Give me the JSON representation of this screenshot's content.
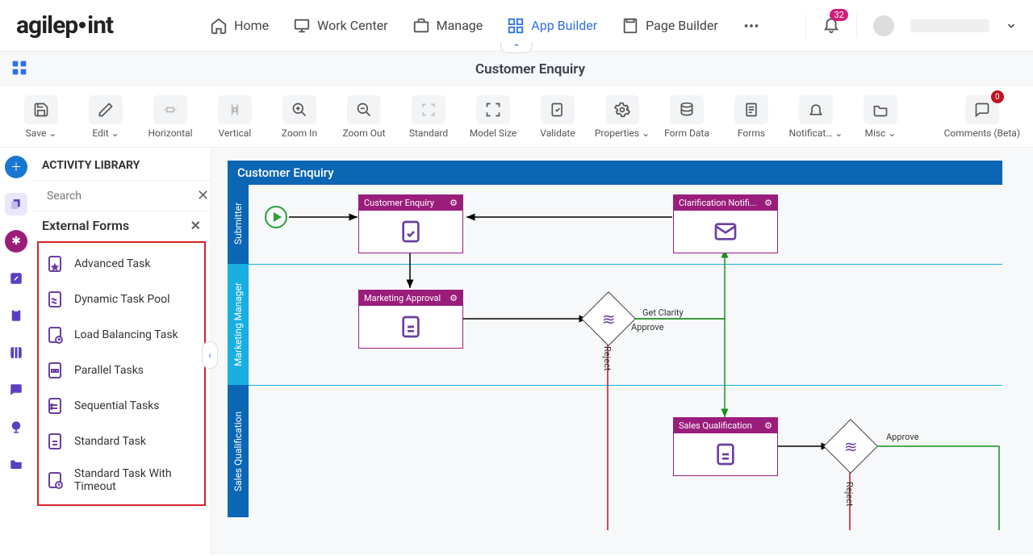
{
  "nav": {
    "home": "Home",
    "workcenter": "Work Center",
    "manage": "Manage",
    "appbuilder": "App Builder",
    "pagebuilder": "Page Builder",
    "notif_count": "32"
  },
  "page": {
    "title": "Customer Enquiry"
  },
  "toolbar": {
    "save": "Save",
    "edit": "Edit",
    "horizontal": "Horizontal",
    "vertical": "Vertical",
    "zoomin": "Zoom In",
    "zoomout": "Zoom Out",
    "standard": "Standard",
    "modelsize": "Model Size",
    "validate": "Validate",
    "properties": "Properties",
    "formdata": "Form Data",
    "forms": "Forms",
    "notifications": "Notificat…",
    "misc": "Misc",
    "comments": "Comments (Beta)",
    "comments_count": "0"
  },
  "library": {
    "heading": "ACTIVITY LIBRARY",
    "search_placeholder": "Search",
    "group": "External Forms",
    "items": [
      "Advanced Task",
      "Dynamic Task Pool",
      "Load Balancing Task",
      "Parallel Tasks",
      "Sequential Tasks",
      "Standard Task",
      "Standard Task With Timeout"
    ]
  },
  "process": {
    "title": "Customer Enquiry",
    "lanes": [
      "Submitter",
      "Marketing Manager",
      "Sales Qualification"
    ],
    "nodes": {
      "n1": "Customer Enquiry",
      "n2": "Clarification Notifi...",
      "n3": "Marketing Approval",
      "n4": "Sales Qualification"
    },
    "edges": {
      "getclarity": "Get Clarity",
      "approve": "Approve",
      "reject": "Reject"
    }
  }
}
